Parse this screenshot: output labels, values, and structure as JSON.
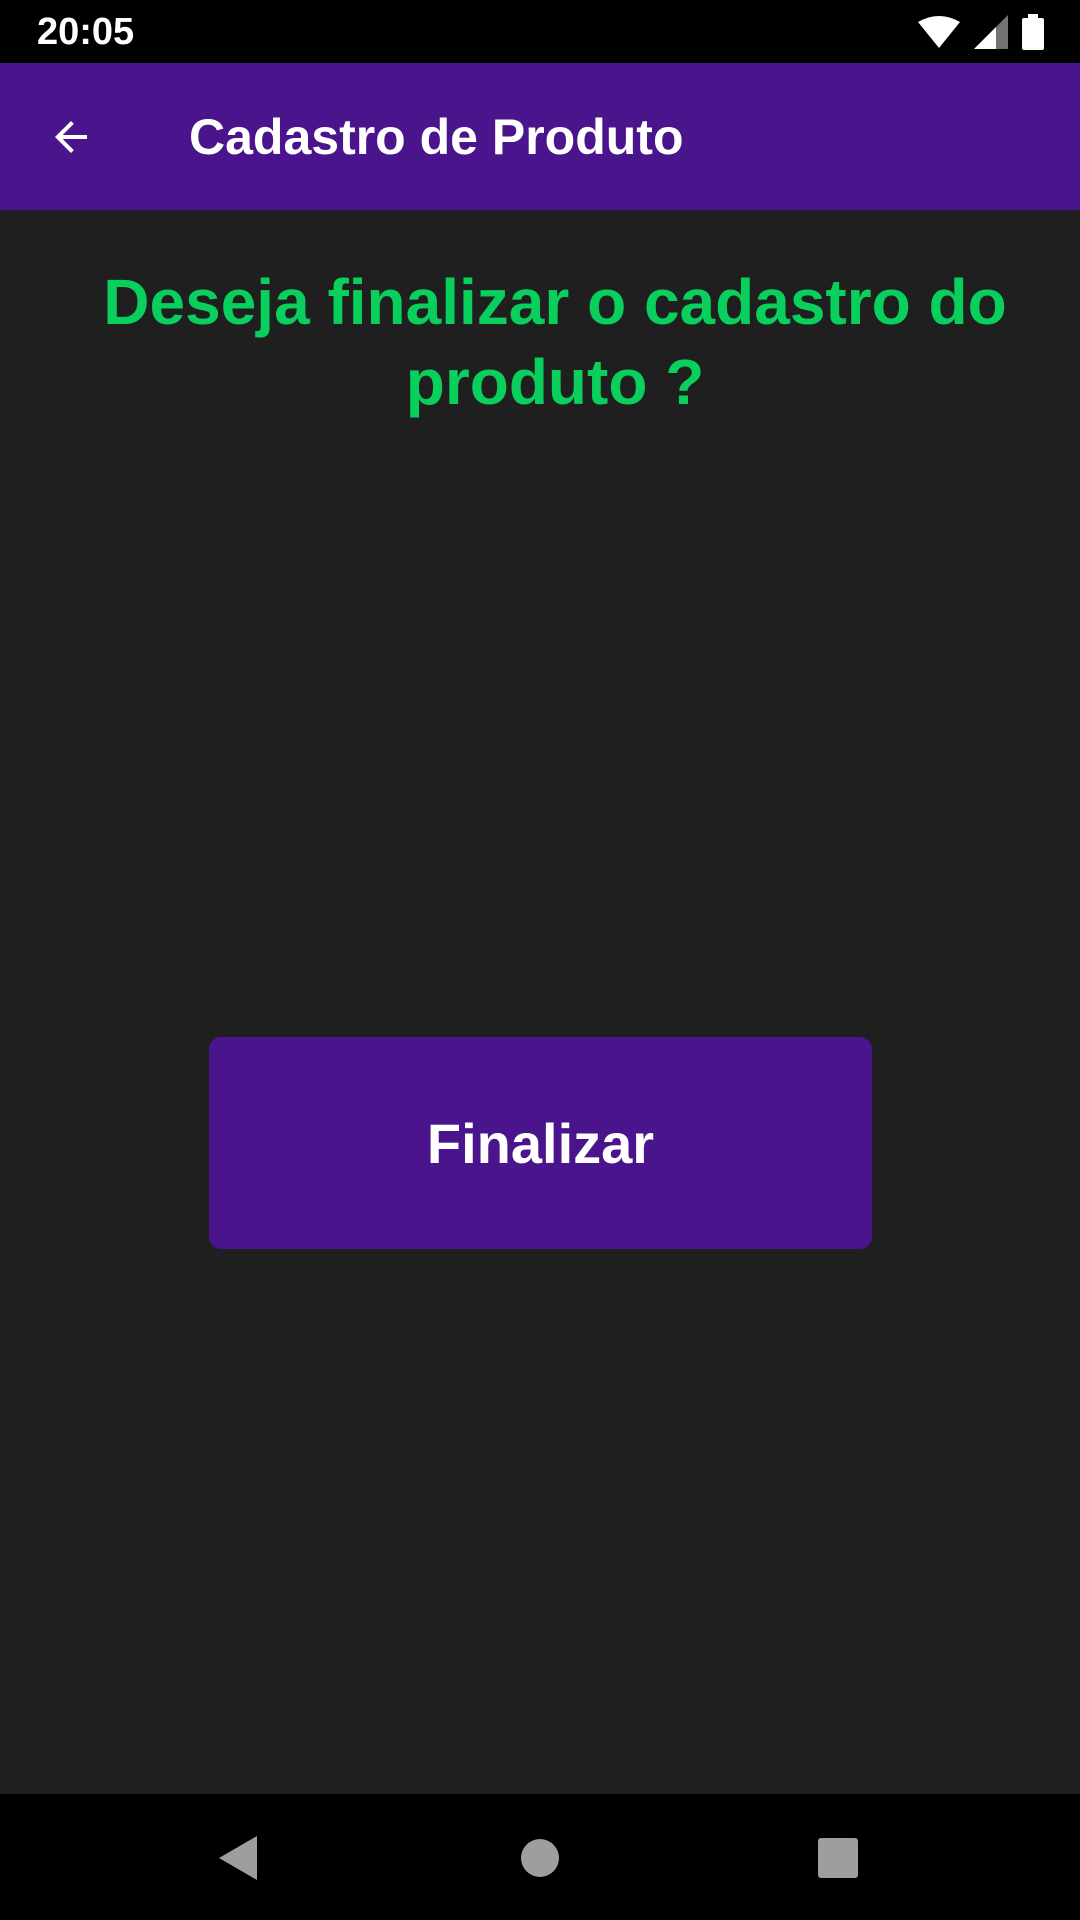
{
  "status_bar": {
    "time": "20:05",
    "icons": [
      "wifi-icon",
      "cell-signal-icon",
      "battery-icon"
    ]
  },
  "app_bar": {
    "title": "Cadastro de Produto",
    "back_icon": "arrow-back-icon"
  },
  "main": {
    "question": "Deseja finalizar o cadastro do produto ?",
    "button_label": "Finalizar"
  },
  "nav_bar": {
    "icons": [
      "back-triangle-icon",
      "home-circle-icon",
      "recents-square-icon"
    ]
  },
  "colors": {
    "primary": "#4a148c",
    "accent_text": "#09cf5c",
    "background": "#1f1f1f"
  }
}
